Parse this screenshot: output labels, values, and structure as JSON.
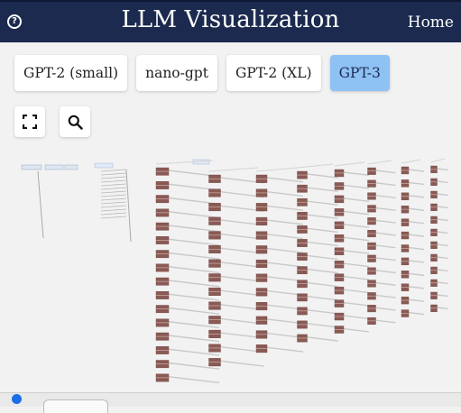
{
  "header": {
    "title": "LLM Visualization",
    "home_label": "Home",
    "help_icon": "question-circle-icon"
  },
  "models": [
    {
      "label": "GPT-2 (small)",
      "active": false
    },
    {
      "label": "nano-gpt",
      "active": false
    },
    {
      "label": "GPT-2 (XL)",
      "active": false
    },
    {
      "label": "GPT-3",
      "active": true
    }
  ],
  "toolbar": {
    "expand_icon": "expand-icon",
    "search_icon": "search-icon"
  },
  "colors": {
    "header_bg": "#1b2a4e",
    "active_button": "#8ec1f4",
    "canvas_bg": "#f2f2f2",
    "layer_block": "#8a5a55",
    "status_dot": "#1a6fe6"
  }
}
